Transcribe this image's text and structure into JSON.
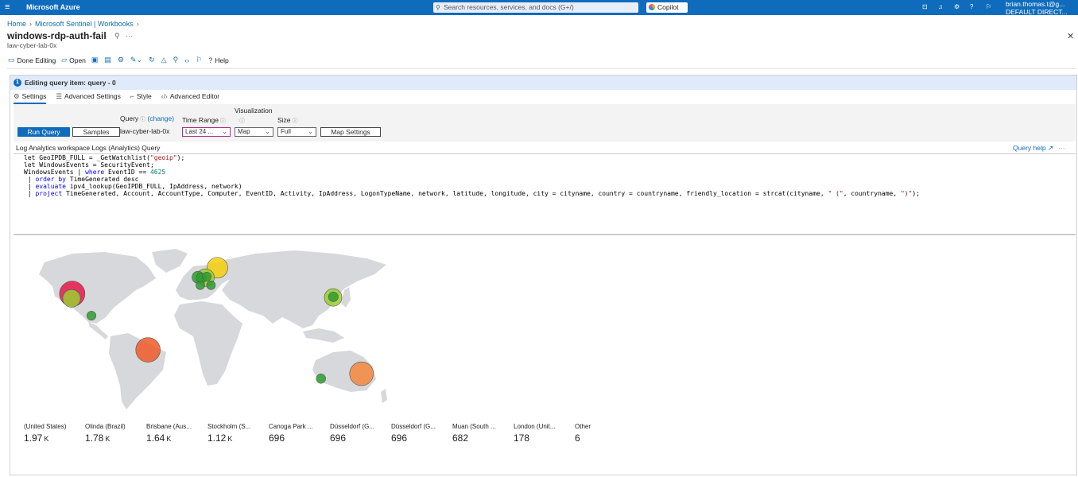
{
  "topbar": {
    "menu_icon": "hamburger-icon",
    "brand": "Microsoft Azure",
    "search_placeholder": "Search resources, services, and docs (G+/)",
    "copilot": "Copilot",
    "user_name": "brian.thomas.t@g...",
    "user_dir": "DEFAULT DIRECT..."
  },
  "breadcrumb": [
    "Home",
    "Microsoft Sentinel | Workbooks"
  ],
  "page": {
    "title": "windows-rdp-auth-fail",
    "subtitle": "law-cyber-lab-0x"
  },
  "toolbar": {
    "done_editing": "Done Editing",
    "open": "Open",
    "help": "Help"
  },
  "editor": {
    "heading": "Editing query item: query - 0",
    "step": "1",
    "tabs": [
      "Settings",
      "Advanced Settings",
      "Style",
      "Advanced Editor"
    ],
    "run_query": "Run Query",
    "samples": "Samples",
    "query_label": "Query",
    "query_change": "(change)",
    "query_value": "law-cyber-lab-0x",
    "time_range_label": "Time Range",
    "time_range_value": "Last 24 ...",
    "visualization_label": "Visualization",
    "visualization_value": "Map",
    "size_label": "Size",
    "size_value": "Full",
    "map_settings": "Map Settings",
    "source_label": "Log Analytics workspace Logs (Analytics) Query",
    "query_help": "Query help"
  },
  "code_lines": [
    "let GeoIPDB_FULL = _GetWatchlist(\"geoip\");",
    "let WindowsEvents = SecurityEvent;",
    "WindowsEvents | where EventID == 4625",
    "| order by TimeGenerated desc",
    "| evaluate ipv4_lookup(GeoIPDB_FULL, IpAddress, network)",
    "| project TimeGenerated, Account, AccountType, Computer, EventID, Activity, IpAddress, LogonTypeName, network, latitude, longitude, city = cityname, country = countryname, friendly_location = strcat(cityname, \" (\", countryname, \")\");"
  ],
  "map_bubbles": [
    {
      "lon": -118,
      "lat": 38,
      "size": 1970,
      "color": "#e6194b"
    },
    {
      "lon": -118.6,
      "lat": 34.2,
      "size": 696,
      "color": "#9acd32"
    },
    {
      "lon": -100,
      "lat": 20,
      "size": 40,
      "color": "#2e9e2e"
    },
    {
      "lon": -47,
      "lat": -8,
      "size": 1780,
      "color": "#f05a28"
    },
    {
      "lon": 18,
      "lat": 59.3,
      "size": 1120,
      "color": "#f5d00d"
    },
    {
      "lon": 6.8,
      "lat": 51.2,
      "size": 696,
      "color": "#9acd32"
    },
    {
      "lon": 3,
      "lat": 50.8,
      "size": 80,
      "color": "#2e9e2e"
    },
    {
      "lon": 8,
      "lat": 52,
      "size": 40,
      "color": "#2e9e2e"
    },
    {
      "lon": -0.1,
      "lat": 51.5,
      "size": 178,
      "color": "#2e9e2e"
    },
    {
      "lon": 2,
      "lat": 45,
      "size": 30,
      "color": "#2e9e2e"
    },
    {
      "lon": 12,
      "lat": 45,
      "size": 30,
      "color": "#2e9e2e"
    },
    {
      "lon": 126.4,
      "lat": 35,
      "size": 682,
      "color": "#9acd32"
    },
    {
      "lon": 126.6,
      "lat": 35.5,
      "size": 60,
      "color": "#2e9e2e"
    },
    {
      "lon": 153,
      "lat": -27.5,
      "size": 1640,
      "color": "#f5883d"
    },
    {
      "lon": 115,
      "lat": -31.5,
      "size": 50,
      "color": "#2e9e2e"
    }
  ],
  "stats": [
    {
      "label": "(United States)",
      "value": "1.97",
      "unit": "K"
    },
    {
      "label": "Olinda (Brazil)",
      "value": "1.78",
      "unit": "K"
    },
    {
      "label": "Brisbane (Aus...",
      "value": "1.64",
      "unit": "K"
    },
    {
      "label": "Stockholm (S...",
      "value": "1.12",
      "unit": "K"
    },
    {
      "label": "Canoga Park ...",
      "value": "696",
      "unit": ""
    },
    {
      "label": "Düsseldorf (G...",
      "value": "696",
      "unit": ""
    },
    {
      "label": "Düsseldorf (G...",
      "value": "696",
      "unit": ""
    },
    {
      "label": "Muan (South ...",
      "value": "682",
      "unit": ""
    },
    {
      "label": "London (Unit...",
      "value": "178",
      "unit": ""
    },
    {
      "label": "Other",
      "value": "6",
      "unit": ""
    }
  ]
}
